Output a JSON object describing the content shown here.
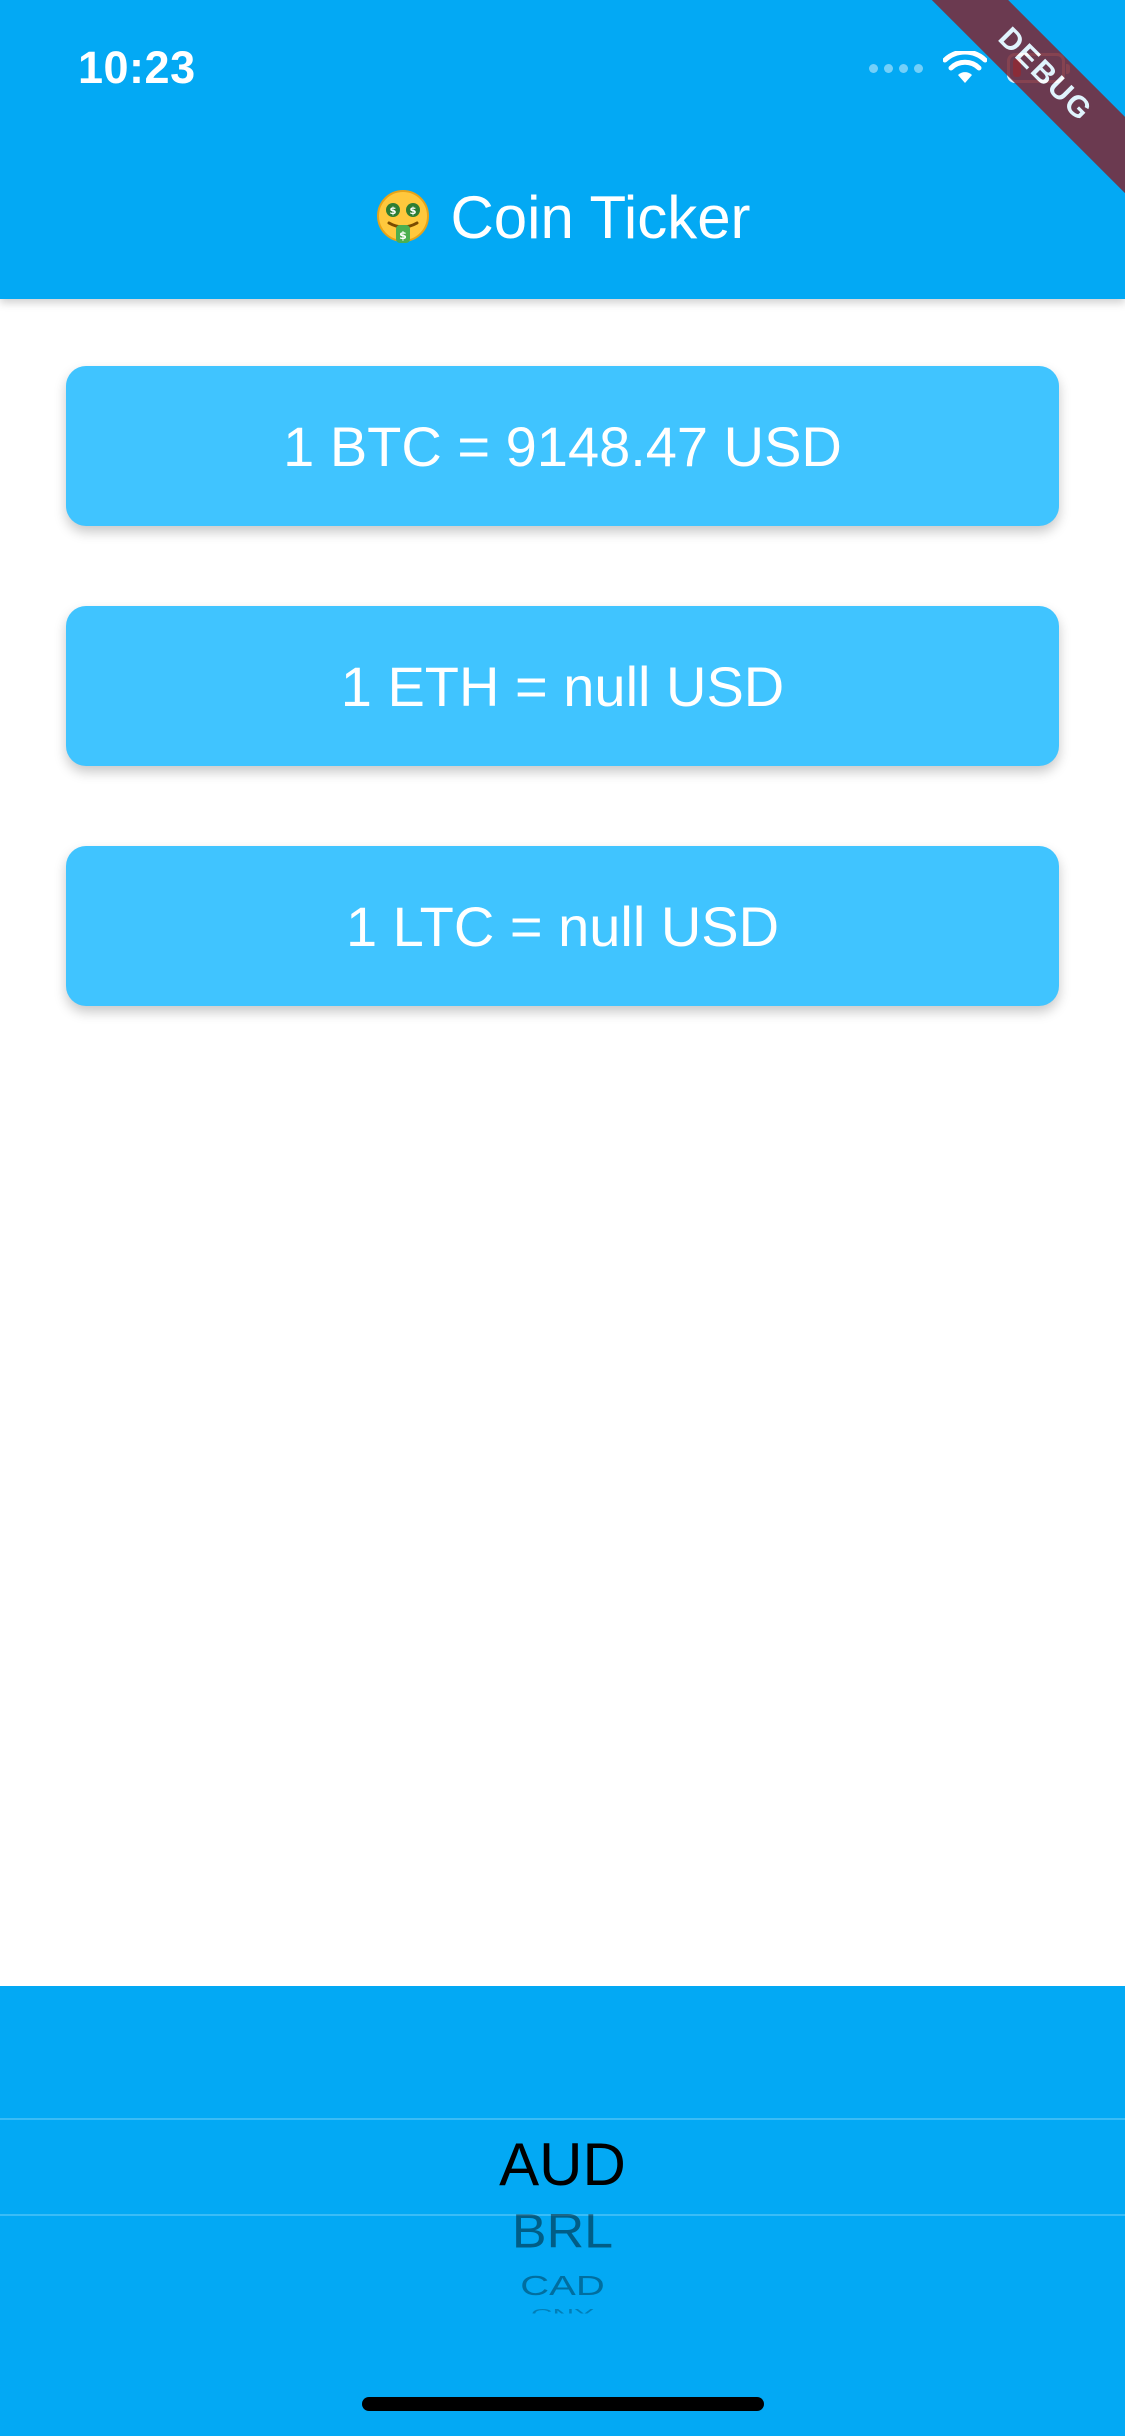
{
  "status_bar": {
    "time": "10:23",
    "icons": [
      "signal-dots-icon",
      "wifi-icon",
      "battery-icon"
    ]
  },
  "app_bar": {
    "emoji_icon": "money-mouth-face-icon",
    "title": "Coin Ticker"
  },
  "debug_banner": {
    "label": "DEBUG"
  },
  "cards": [
    {
      "label": "1 BTC = 9148.47 USD"
    },
    {
      "label": "1 ETH = null USD"
    },
    {
      "label": "1 LTC = null USD"
    }
  ],
  "picker": {
    "selected": "AUD",
    "visible_items": [
      "AUD",
      "BRL",
      "CAD",
      "CNY"
    ]
  },
  "colors": {
    "primary": "#03A9F4",
    "card": "#40C4FF",
    "debug_banner": "#7a2b3a"
  }
}
